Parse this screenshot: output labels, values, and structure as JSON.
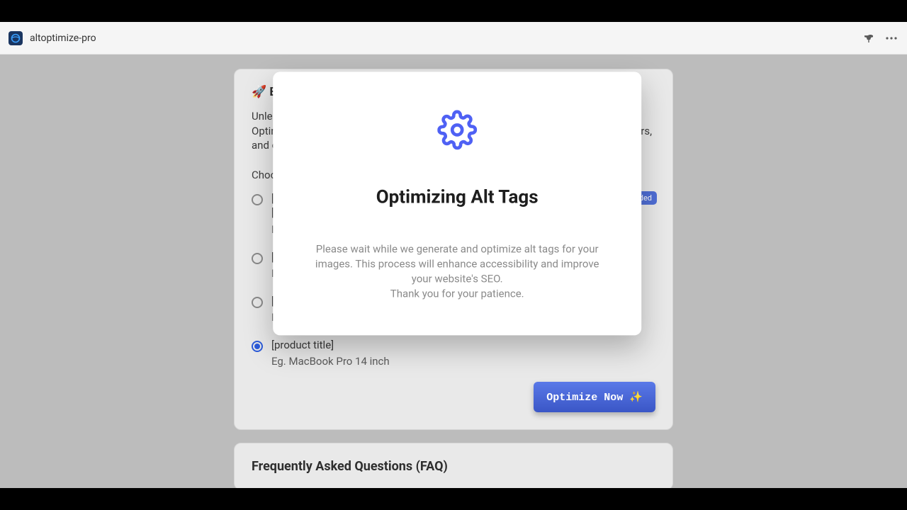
{
  "topbar": {
    "app_name": "altoptimize-pro"
  },
  "card": {
    "title": "🚀 Elevate Your SEO Game with AltOptimize Pro! 🚀",
    "description": "Unleash the potential of AltOptimize Pro for a boosted online presence! 📈✨ Optimize your image alt tags effortlessly, enhancing visibility, attracting more visitors, and driving significant sales.",
    "choose_label": "Choose",
    "options": [
      {
        "line1": "[product title] - [variant title]",
        "line2": "[vendor name]",
        "example": "Eg.",
        "badge": "ded",
        "checked": false
      },
      {
        "line1": "[product title]",
        "example": "Eg.",
        "checked": false
      },
      {
        "line1": "[product title]",
        "example": "Eg.",
        "checked": false
      },
      {
        "line1": "[product title]",
        "example": "Eg. MacBook Pro 14 inch",
        "checked": true
      }
    ],
    "optimize_button": "Optimize Now ✨"
  },
  "faq": {
    "title": "Frequently Asked Questions (FAQ)"
  },
  "modal": {
    "title": "Optimizing Alt Tags",
    "body1": "Please wait while we generate and optimize alt tags for your images. This process will enhance accessibility and improve your website's SEO.",
    "body2": "Thank you for your patience."
  }
}
